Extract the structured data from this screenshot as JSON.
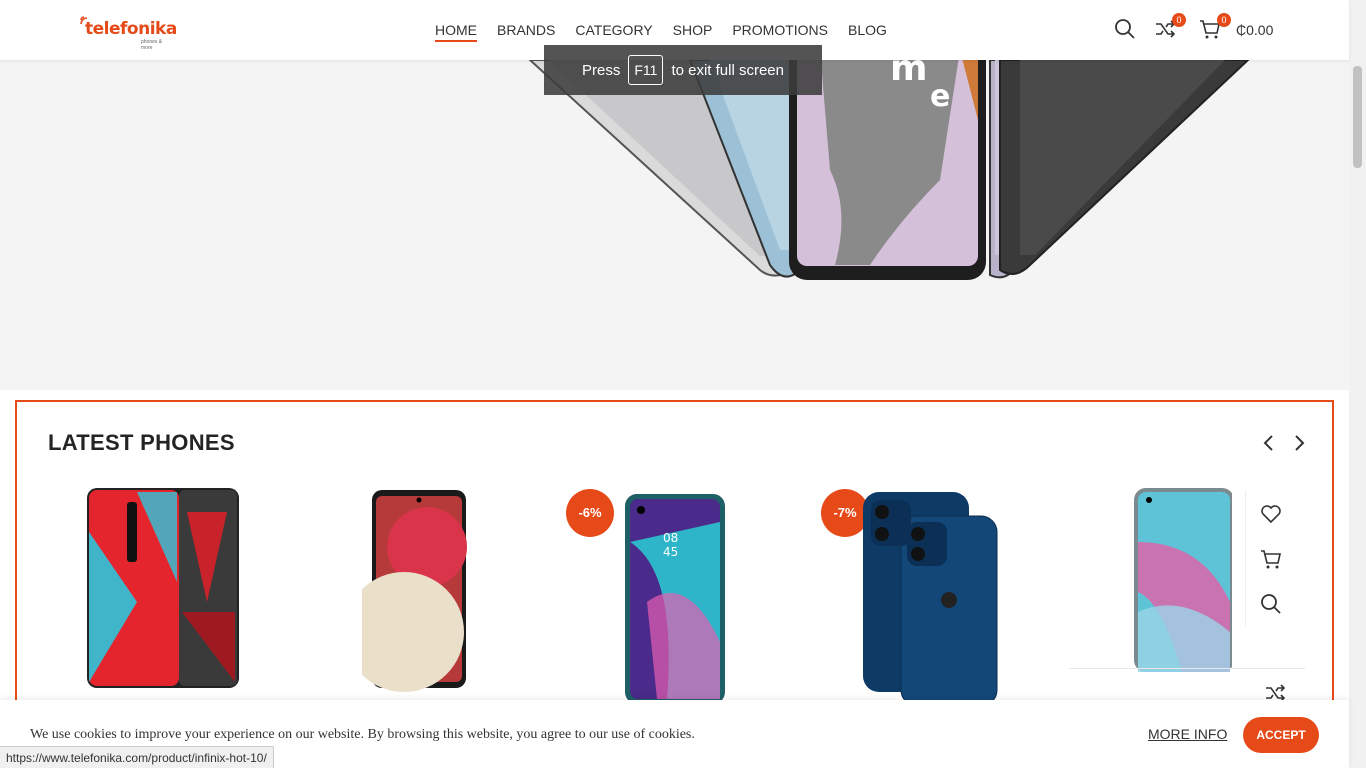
{
  "header": {
    "logo_text": "telefonika",
    "logo_sub": "phones & more",
    "nav": [
      {
        "label": "HOME"
      },
      {
        "label": "BRANDS"
      },
      {
        "label": "CATEGORY"
      },
      {
        "label": "SHOP"
      },
      {
        "label": "PROMOTIONS"
      },
      {
        "label": "BLOG"
      }
    ],
    "compare_count": "0",
    "cart_count": "0",
    "cart_total": "₵0.00"
  },
  "fullscreen_toast": {
    "press": "Press",
    "key": "F11",
    "suffix": "to exit full screen"
  },
  "latest": {
    "title": "LATEST PHONES",
    "products": [
      {
        "icon": "red-magic-phone-image",
        "discount": ""
      },
      {
        "icon": "samsung-galaxy-phone-image",
        "discount": ""
      },
      {
        "icon": "tecno-camon-phone-image",
        "discount": "-6%"
      },
      {
        "icon": "iphone-12-image",
        "discount": "-7%"
      },
      {
        "icon": "infinix-hot-phone-image",
        "discount": ""
      }
    ]
  },
  "cookie": {
    "text": "We use cookies to improve your experience on our website. By browsing this website, you agree to our use of cookies.",
    "more_info": "MORE INFO",
    "accept": "ACCEPT"
  },
  "status_url": "https://www.telefonika.com/product/infinix-hot-10/",
  "colors": {
    "accent": "#e64a19",
    "hero_bg": "#f3f4f3"
  }
}
